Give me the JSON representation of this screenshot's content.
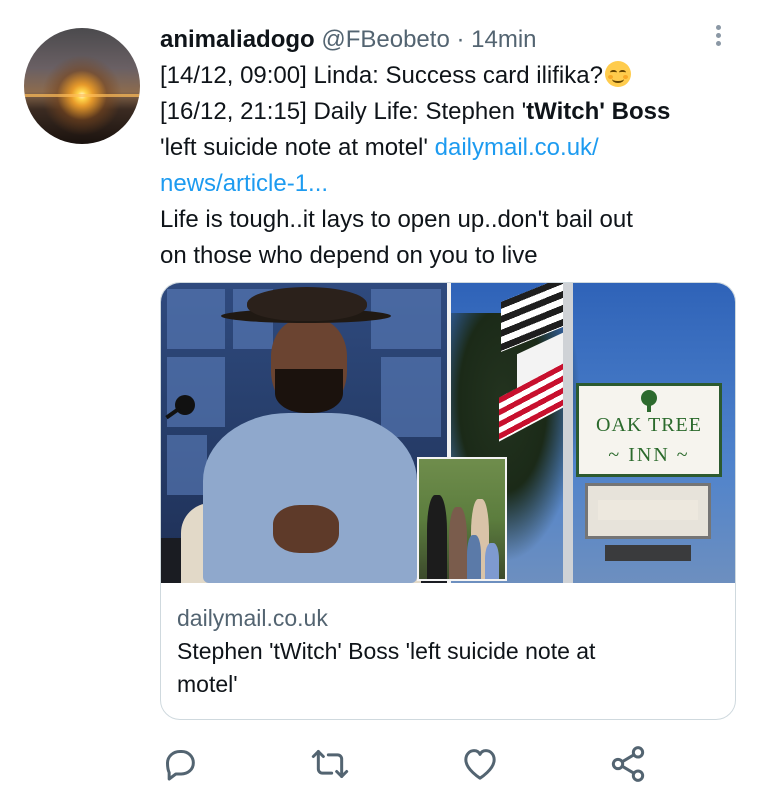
{
  "tweet": {
    "author_name": "animaliadogo",
    "author_handle": "@FBeobeto",
    "separator": "·",
    "time": "14min",
    "line1": "[14/12, 09:00] Linda: Success card ilifika?",
    "line2_prefix": "[16/12, 21:15] Daily Life: Stephen '",
    "line2_bold": "tWitch' Boss",
    "line3_text": "'left suicide note at motel' ",
    "link_part1": "dailymail.co.uk/",
    "link_part2": "news/article-1...",
    "line5": "Life is tough..it lays to open up..don't bail out",
    "line6": "on those who depend on you to live"
  },
  "card": {
    "domain": "dailymail.co.uk",
    "title_line1": "Stephen 'tWitch' Boss 'left suicide note at",
    "title_line2": "motel'",
    "sign_line1": "OAK TREE",
    "sign_line2": "~ INN ~"
  },
  "icons": {
    "more": "more-vertical-icon",
    "reply": "reply-icon",
    "retweet": "retweet-icon",
    "like": "heart-icon",
    "share": "share-icon",
    "emoji": "smiling-face-emoji"
  },
  "colors": {
    "link": "#1d9bf0",
    "meta": "#536471",
    "icon": "#536471",
    "border": "#cfd9de"
  }
}
